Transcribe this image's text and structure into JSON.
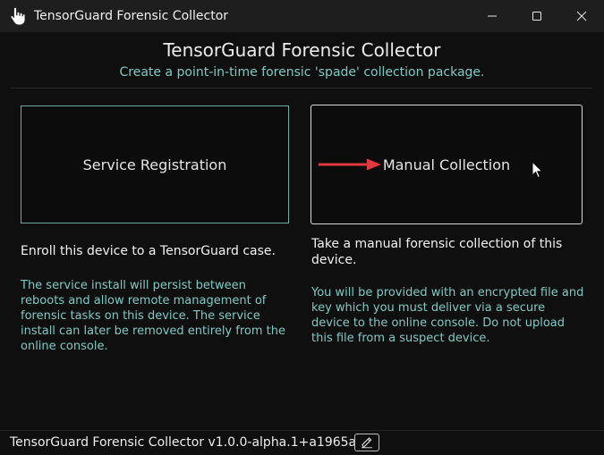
{
  "window": {
    "title": "TensorGuard Forensic Collector",
    "icons": {
      "app": "hand-pointer-icon",
      "minimize": "minimize-icon",
      "maximize": "maximize-icon",
      "close": "close-icon"
    }
  },
  "header": {
    "title": "TensorGuard Forensic Collector",
    "subtitle": "Create a point-in-time forensic 'spade' collection package."
  },
  "options": [
    {
      "label": "Service Registration",
      "heading": "Enroll this device to a TensorGuard case.",
      "description": "The service install will persist between reboots and allow remote management of forensic tasks on this device. The service install can later be removed entirely from the online console."
    },
    {
      "label": "Manual Collection",
      "heading": "Take a manual forensic collection of this device.",
      "description": "You will be provided with an encrypted file and key which you must deliver via a secure device to the online console. Do not upload this file from a suspect device."
    }
  ],
  "footer": {
    "version": "TensorGuard Forensic Collector v1.0.0-alpha.1+a1965a",
    "edit_icon": "edit-icon"
  },
  "colors": {
    "accent": "#7fc9c3",
    "arrow": "#e0393e",
    "background": "#0f0f0f",
    "titlebar": "#1e1e1e"
  }
}
